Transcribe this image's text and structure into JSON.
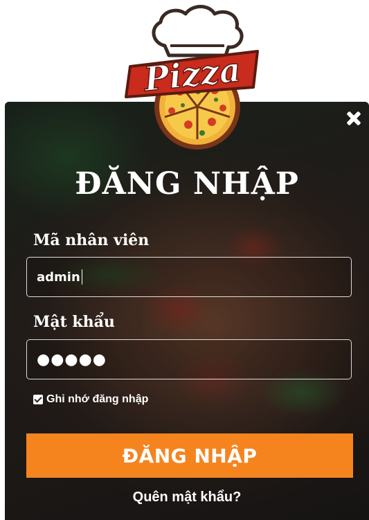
{
  "logo": {
    "text": "Pizza",
    "icon": "pizza-chef-hat-logo"
  },
  "dialog": {
    "title": "ĐĂNG NHẬP",
    "close_icon": "close-icon"
  },
  "form": {
    "username_label": "Mã nhân viên",
    "username_value": "admin",
    "password_label": "Mật khẩu",
    "password_mask": "●●●●●",
    "remember_label": "Ghi nhớ đăng nhập",
    "remember_checked": true,
    "submit_label": "ĐĂNG NHẬP",
    "forgot_label": "Quên mật khẩu?"
  },
  "colors": {
    "accent": "#f5841f",
    "logo_red": "#d32f1f",
    "text": "#ffffff"
  }
}
